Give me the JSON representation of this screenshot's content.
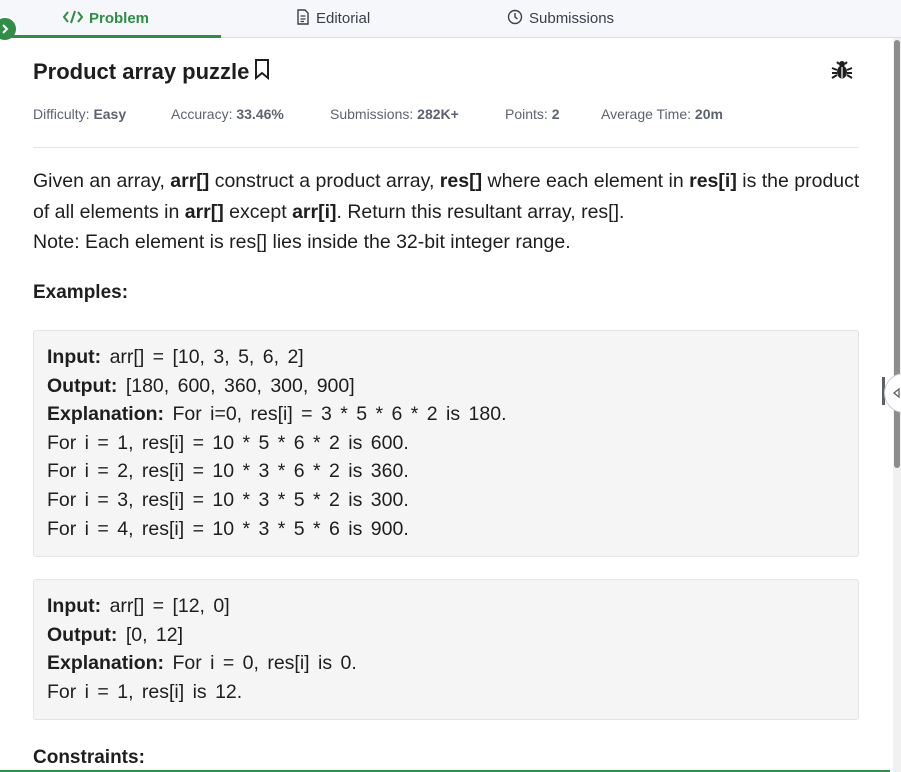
{
  "tabs": [
    {
      "label": "Problem",
      "icon": "code-icon",
      "active": true
    },
    {
      "label": "Editorial",
      "icon": "document-icon",
      "active": false
    },
    {
      "label": "Submissions",
      "icon": "clock-icon",
      "active": false
    }
  ],
  "problem": {
    "title": "Product array puzzle",
    "meta": {
      "difficulty_label": "Difficulty:",
      "difficulty_value": "Easy",
      "accuracy_label": "Accuracy:",
      "accuracy_value": "33.46%",
      "submissions_label": "Submissions:",
      "submissions_value": "282K+",
      "points_label": "Points:",
      "points_value": "2",
      "avg_time_label": "Average Time:",
      "avg_time_value": "20m"
    },
    "description": {
      "p1_a": "Given an array, ",
      "p1_b": "arr[]",
      "p1_c": " construct a product array, ",
      "p1_d": "res[]",
      "p1_e": " where each element in ",
      "p1_f": "res[i]",
      "p1_g": " is the product of all elements in ",
      "p1_h": "arr[]",
      "p1_i": " except ",
      "p1_j": "arr[i]",
      "p1_k": ". Return this resultant array, res[].",
      "note": "Note: Each element is res[] lies inside the 32-bit integer range."
    },
    "examples_heading": "Examples:",
    "examples": [
      {
        "input_label": "Input:",
        "input": "arr[] = [10, 3, 5, 6, 2]",
        "output_label": "Output:",
        "output": "[180, 600, 360, 300, 900]",
        "explanation_label": "Explanation:",
        "explanation": "For i=0, res[i] = 3 * 5 * 6 * 2 is 180.",
        "extra": [
          "For i = 1, res[i] = 10 * 5 * 6 * 2 is 600.",
          "For i = 2, res[i] = 10 * 3 * 6 * 2 is 360.",
          "For i = 3, res[i] = 10 * 3 * 5 * 2 is 300.",
          "For i = 4, res[i] = 10 * 3 * 5 * 6 is 900."
        ]
      },
      {
        "input_label": "Input:",
        "input": "arr[] = [12, 0]",
        "output_label": "Output:",
        "output": "[0, 12]",
        "explanation_label": "Explanation:",
        "explanation": "For i = 0, res[i] is 0.",
        "extra": [
          "For i = 1, res[i] is 12."
        ]
      }
    ],
    "constraints_heading": "Constraints:"
  },
  "colors": {
    "accent": "#2f8d46",
    "text": "#1e1e1e",
    "muted": "#5c6370",
    "example_bg": "#f5f5f5"
  }
}
